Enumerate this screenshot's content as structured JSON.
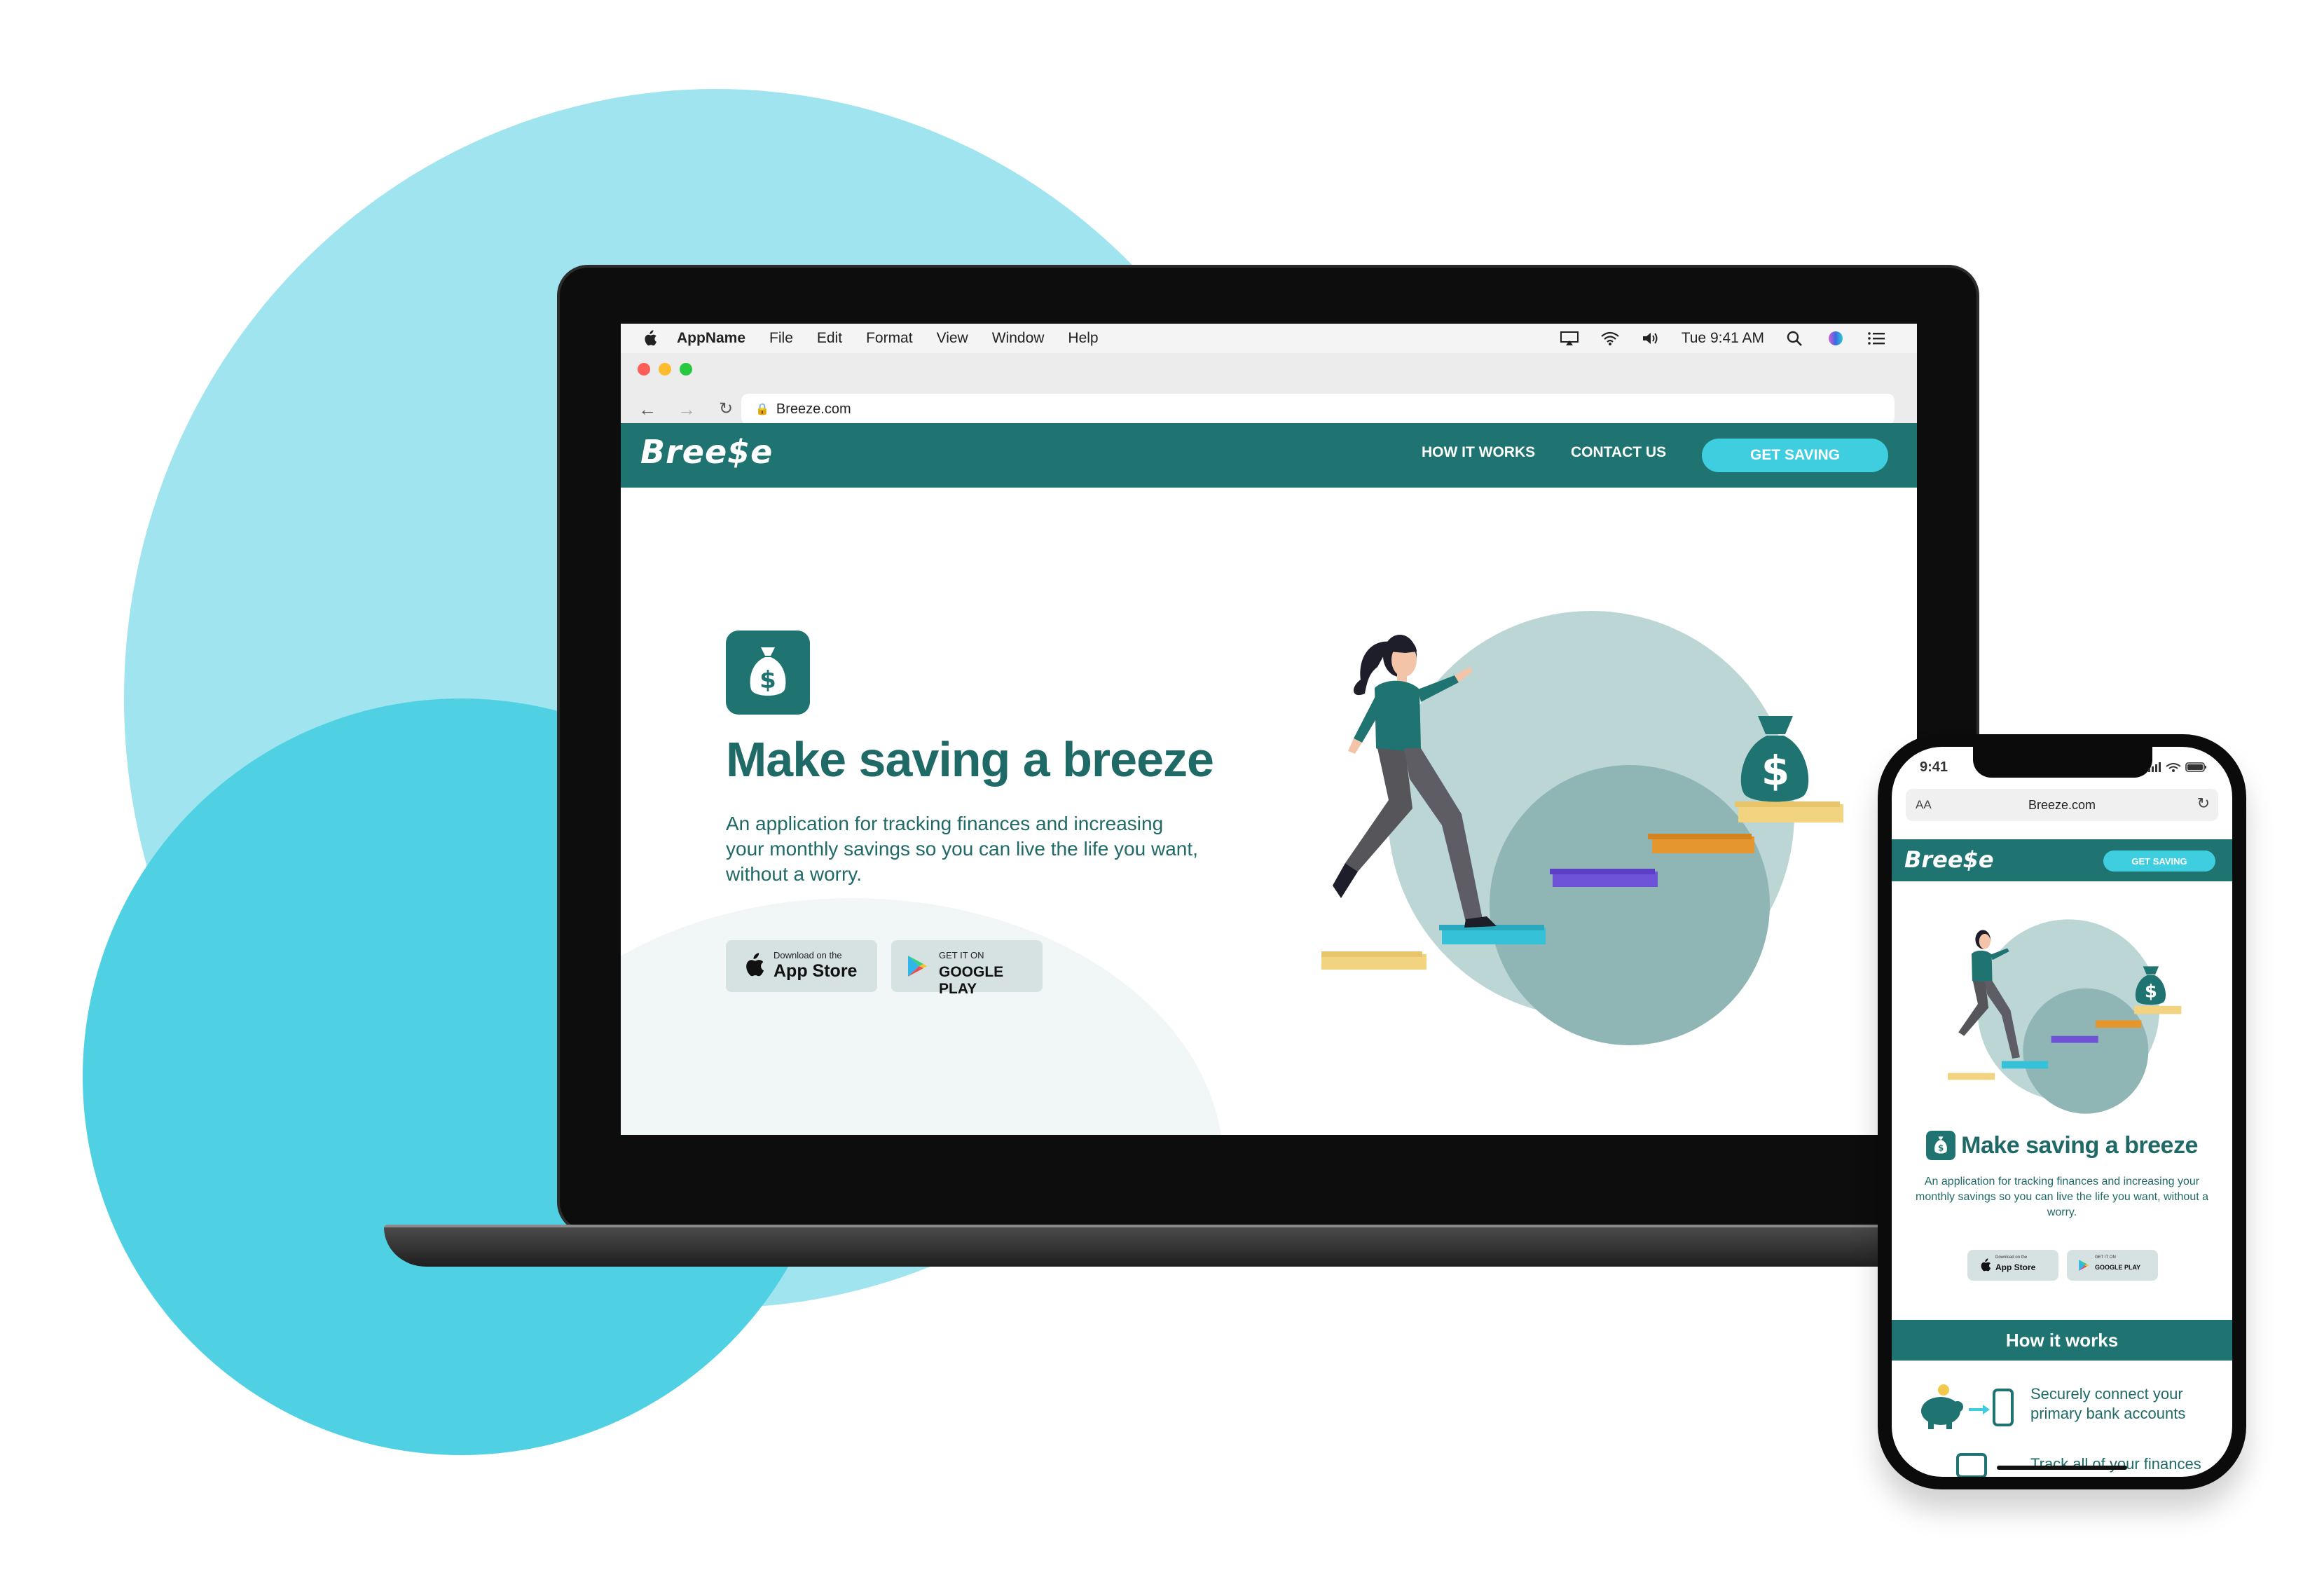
{
  "menubar": {
    "app_name": "AppName",
    "items": [
      "File",
      "Edit",
      "Format",
      "View",
      "Window",
      "Help"
    ],
    "clock": "Tue 9:41 AM"
  },
  "browser": {
    "url": "Breeze.com"
  },
  "site": {
    "logo": "Bree$e",
    "nav": {
      "how_it_works": "HOW IT WORKS",
      "contact_us": "CONTACT US",
      "cta": "GET SAVING"
    },
    "hero": {
      "title": "Make saving a breeze",
      "description": "An application for tracking finances and increasing your monthly savings so you can live the life you want, without a worry."
    },
    "store_buttons": {
      "app_store_small": "Download on the",
      "app_store_big": "App Store",
      "google_small": "GET IT ON",
      "google_big": "GOOGLE PLAY"
    },
    "mobile": {
      "time": "9:41",
      "aa": "AA",
      "how_it_works_heading": "How it works",
      "step1": "Securely connect your primary bank accounts",
      "step2": "Track all of your finances"
    }
  },
  "colors": {
    "brand_teal": "#1f7471",
    "accent_cyan": "#3fcde0",
    "blob_light": "#9fe4ee",
    "blob_dark": "#4fd1e3"
  }
}
